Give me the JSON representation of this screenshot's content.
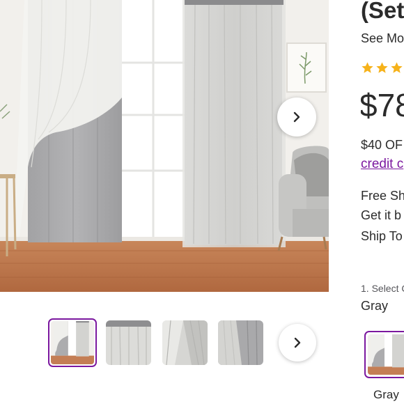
{
  "product": {
    "title": "(Set",
    "see_more": "See Mo",
    "rating_stars": 3,
    "price": "$78",
    "promo_text": "$40 OF",
    "credit_link": "credit c",
    "shipping": [
      "Free Sh",
      "Get it b",
      "Ship To"
    ]
  },
  "options": {
    "select_label": "1. Select C",
    "selected_value": "Gray",
    "swatch_label": "Gray"
  },
  "gallery": {
    "thumbnail_count": 4,
    "active_thumbnail": 1
  },
  "colors": {
    "accent": "#7b189f",
    "star": "#f6b21a",
    "text": "#2b2b2b"
  },
  "icons": {
    "hero_next": "chevron-right-icon",
    "thumb_next": "chevron-right-icon",
    "star": "star-icon"
  }
}
